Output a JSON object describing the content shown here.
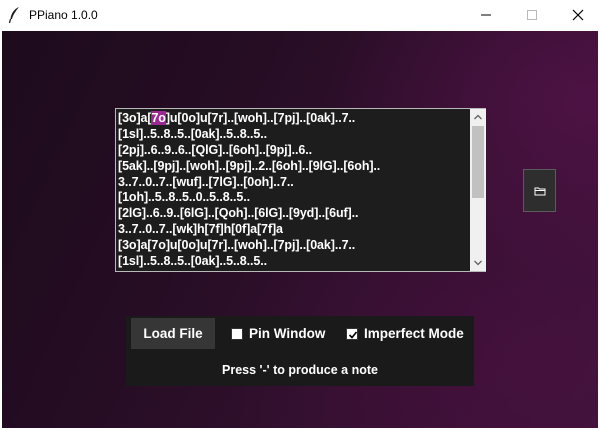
{
  "window": {
    "title": "PPiano 1.0.0",
    "icon": "feather-icon",
    "controls": [
      "minimize-icon",
      "maximize-icon",
      "close-icon"
    ]
  },
  "sheet": {
    "lines": [
      "[3o]a[7o]u[0o]u[7r]..[woh]..[7pj]..[0ak]..7..",
      "[1sl]..5..8..5..[0ak]..5..8..5..",
      "[2pj]..6..9..6..[QlG]..[6oh]..[9pj]..6..",
      "[5ak]..[9pj]..[woh]..[9pj]..2..[6oh]..[9lG]..[6oh]..",
      "3..7..0..7..[wuf]..[7lG]..[0oh]..7..",
      "[1oh]..5..8..5..0..5..8..5..",
      "[2lG]..6..9..[6lG]..[Qoh]..[6lG]..[9yd]..[6uf]..",
      "3..7..0..7..[wk]h[7f]h[0f]a[7f]a",
      "[3o]a[7o]u[0o]u[7r]..[woh]..[7pj]..[0ak]..7..",
      "[1sl]..5..8..5..[0ak]..5..8..5.."
    ],
    "highlight": {
      "before": "[3o]a[",
      "text": "7o",
      "after": "]u[0o]u[7r]..[woh]..[7pj]..[0ak]..7.."
    },
    "highlight_color": "#9a2a91"
  },
  "side_button": {
    "icon": "folder-icon"
  },
  "controls": {
    "load_label": "Load File",
    "pin_label": "Pin Window",
    "pin_checked": false,
    "imperfect_label": "Imperfect Mode",
    "imperfect_checked": true,
    "hint": "Press '-' to produce a note"
  },
  "colors": {
    "background_dark": "#1d0b1c",
    "background_accent": "#5f1252",
    "panel": "#1a1a1a",
    "button": "#363636",
    "text": "#ffffff"
  }
}
